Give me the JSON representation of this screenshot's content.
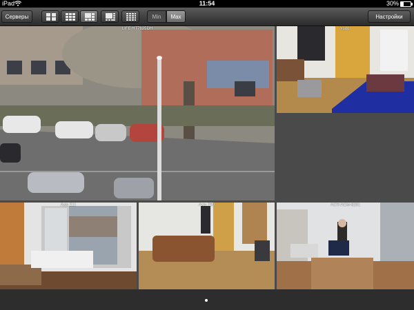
{
  "status_bar": {
    "carrier": "iPad",
    "time": "11:54",
    "battery": "30%",
    "battery_level": 0.3
  },
  "toolbar": {
    "servers_label": "Серверы",
    "settings_label": "Настройки",
    "layouts": [
      {
        "name": "layout-2x2",
        "active": false
      },
      {
        "name": "layout-3x3",
        "active": false
      },
      {
        "name": "layout-1plus5",
        "active": true
      },
      {
        "name": "layout-1plus7",
        "active": false
      },
      {
        "name": "layout-4x4",
        "active": false
      }
    ],
    "min_label": "Min",
    "max_label": "Max"
  },
  "cameras": [
    {
      "label": "LIFE HT7625DH"
    },
    {
      "label": "Yudor"
    },
    {
      "label": ""
    },
    {
      "label": "Axis 211"
    },
    {
      "label": "Axis 250"
    },
    {
      "label": "ACTi  ACM-8201"
    }
  ],
  "page_indicator": {
    "pages": 1,
    "current": 1
  }
}
